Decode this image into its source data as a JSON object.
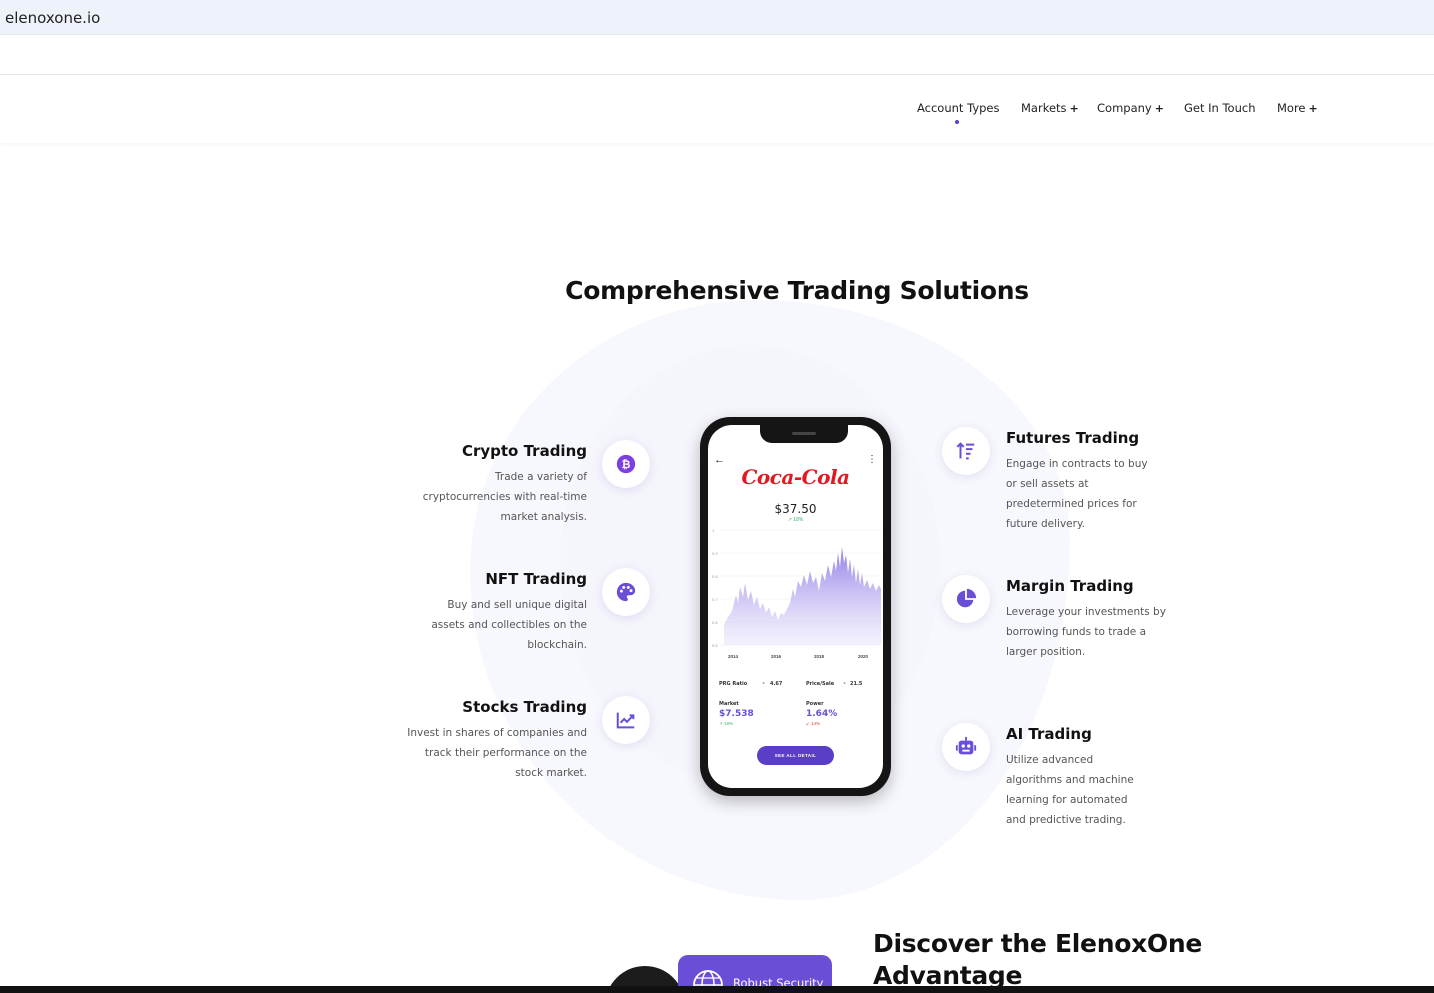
{
  "browser": {
    "url": "elenoxone.io"
  },
  "nav": {
    "items": [
      {
        "label": "Account Types",
        "has_plus": false
      },
      {
        "label": "Markets",
        "has_plus": true
      },
      {
        "label": "Company",
        "has_plus": true
      },
      {
        "label": "Get In Touch",
        "has_plus": false
      },
      {
        "label": "More",
        "has_plus": true
      }
    ],
    "plus": "+"
  },
  "section": {
    "title": "Comprehensive Trading Solutions"
  },
  "features_left": [
    {
      "title": "Crypto Trading",
      "desc": "Trade a variety of cryptocurrencies with real-time market analysis.",
      "icon": "bitcoin-icon"
    },
    {
      "title": "NFT Trading",
      "desc": "Buy and sell unique digital assets and collectibles on the blockchain.",
      "icon": "palette-icon"
    },
    {
      "title": "Stocks Trading",
      "desc": "Invest in shares of companies and track their performance on the stock market.",
      "icon": "chart-line-icon"
    }
  ],
  "features_right": [
    {
      "title": "Futures Trading",
      "desc": "Engage in contracts to buy or sell assets at predetermined prices for future delivery.",
      "icon": "sort-up-icon"
    },
    {
      "title": "Margin Trading",
      "desc": "Leverage your investments by borrowing funds to trade a larger position.",
      "icon": "pie-chart-icon"
    },
    {
      "title": "AI Trading",
      "desc": "Utilize advanced algorithms and machine learning for automated and predictive trading.",
      "icon": "robot-icon"
    }
  ],
  "phone": {
    "brand": "Coca-Cola",
    "price": "$37.50",
    "change": "↗ 18%",
    "years": [
      "2014",
      "2016",
      "2018",
      "2020"
    ],
    "y_ticks": [
      "1",
      "0.9",
      "0.8",
      "0.7",
      "0.6",
      "0.5"
    ],
    "prg_ratio_label": "PRG Ratio",
    "prg_ratio_value": "4.67",
    "price_sale_label": "Price/Sale",
    "price_sale_value": "21.5",
    "market_label": "Market",
    "market_value": "$7.538",
    "market_change": "↗ 18%",
    "power_label": "Power",
    "power_value": "1.64%",
    "power_change": "↙ 14%",
    "button": "SEE ALL DETAIL"
  },
  "advantage": {
    "title_line1": "Discover the ElenoxOne",
    "title_line2": "Advantage",
    "badge": "Robust Security"
  },
  "colors": {
    "accent": "#6a4fd6",
    "brand_red": "#e01a22"
  }
}
